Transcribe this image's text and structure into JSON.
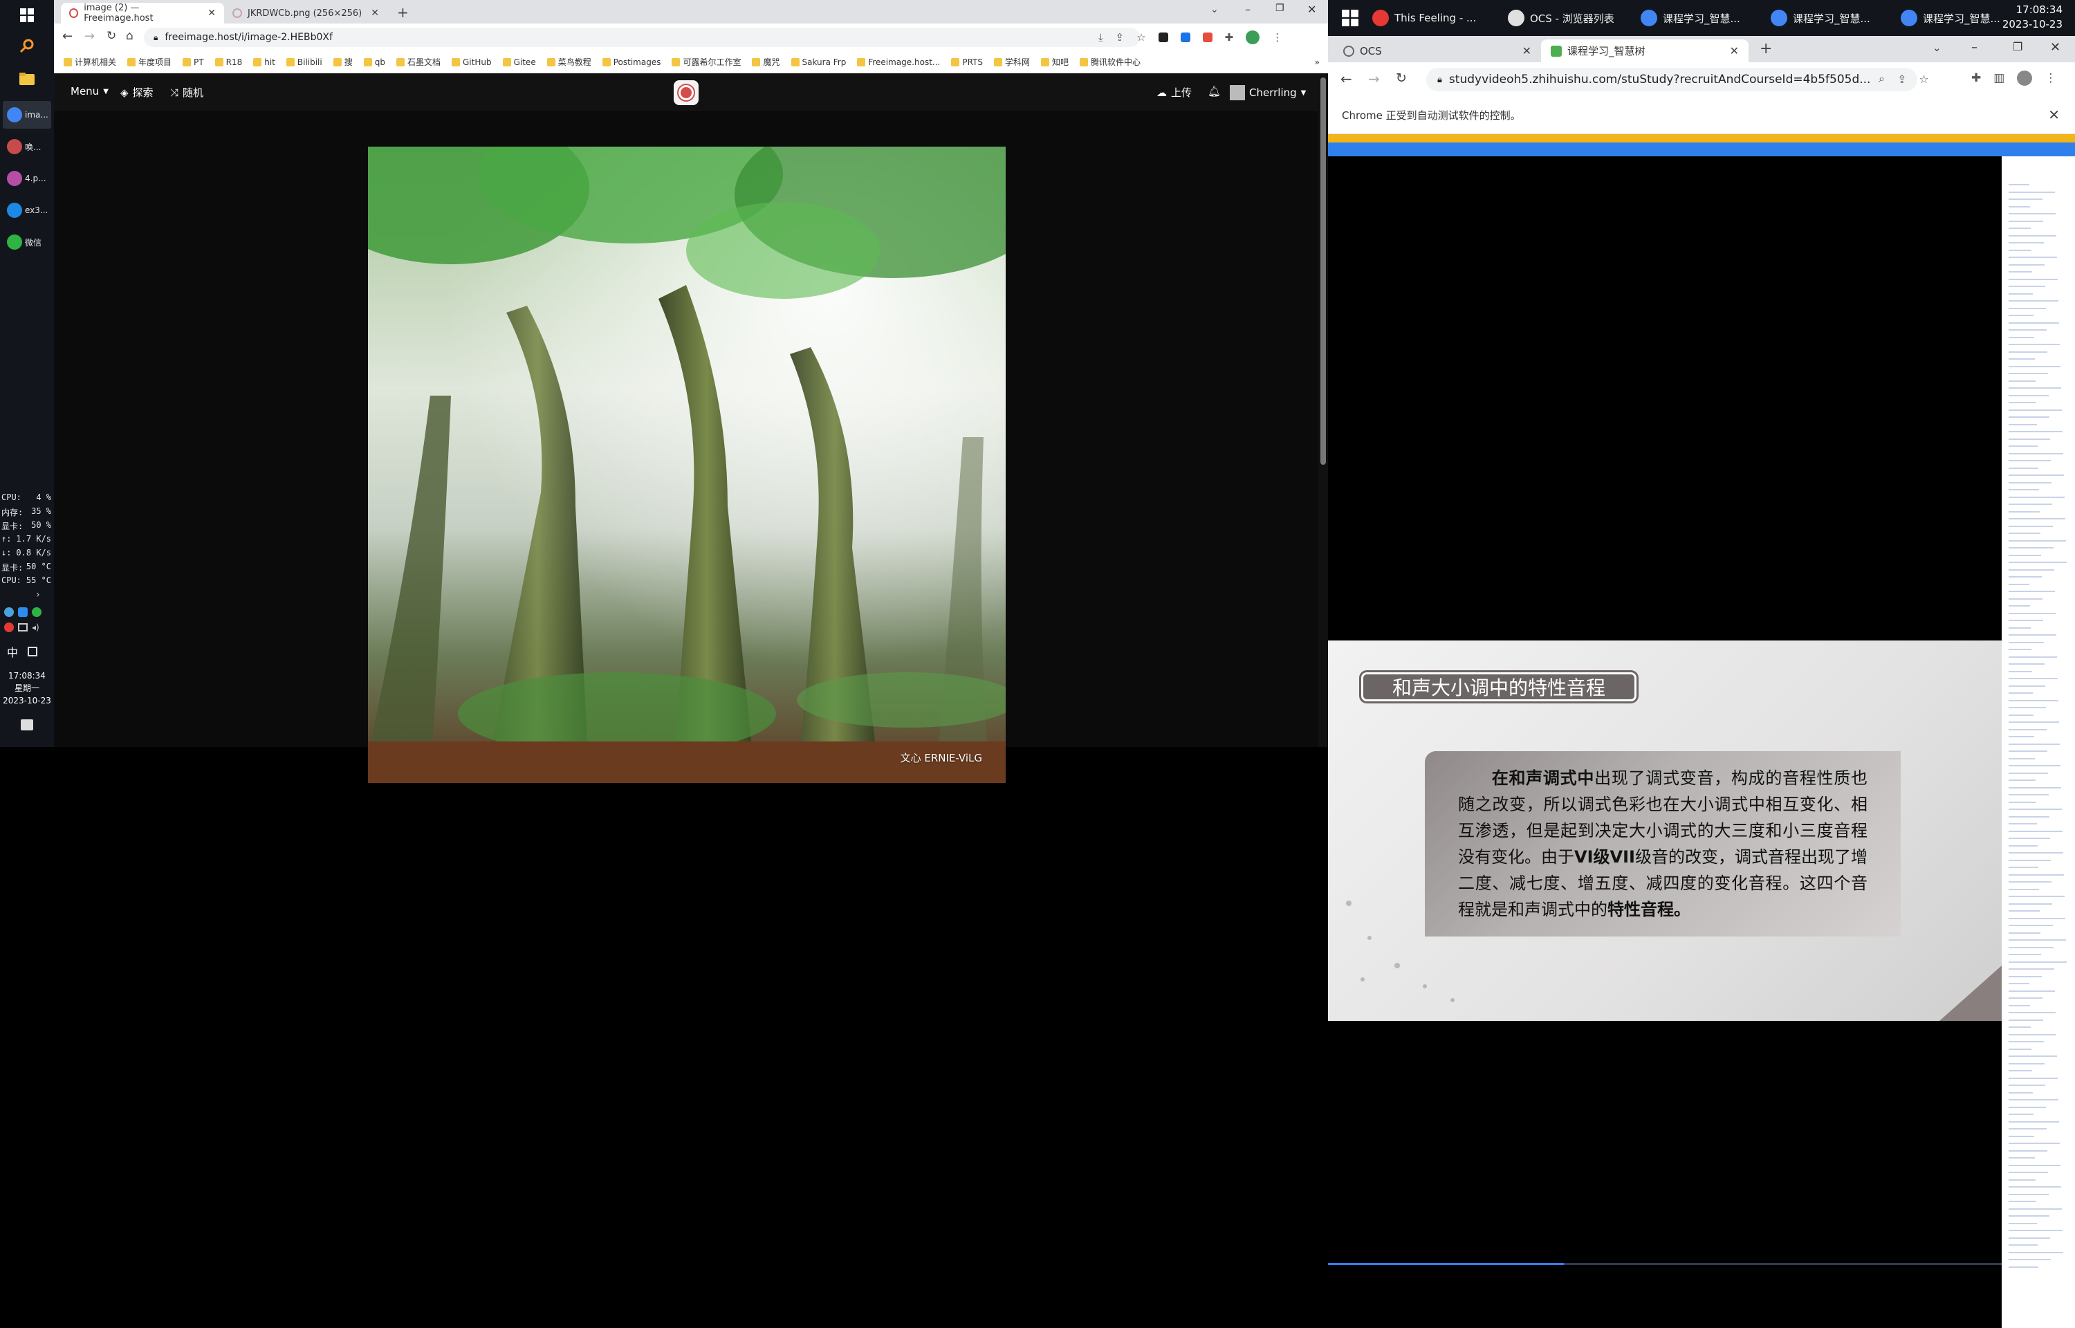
{
  "left": {
    "taskbar": {
      "apps": [
        {
          "label": "ima...",
          "color": "#4285f4",
          "active": true
        },
        {
          "label": "唤...",
          "color": "#c84b4b",
          "active": false
        },
        {
          "label": "4.p...",
          "color": "#b64ea8",
          "active": false
        },
        {
          "label": "ex3...",
          "color": "#1e88e5",
          "active": false
        },
        {
          "label": "微信",
          "color": "#2fb344",
          "active": false
        }
      ],
      "stats": [
        {
          "k": "CPU:",
          "v": "4 %"
        },
        {
          "k": "内存:",
          "v": "35 %"
        },
        {
          "k": "显卡:",
          "v": "50 %"
        },
        {
          "k": "↑:",
          "v": "1.7 K/s"
        },
        {
          "k": "↓:",
          "v": "0.8 K/s"
        },
        {
          "k": "显卡:",
          "v": "50 °C"
        },
        {
          "k": "CPU:",
          "v": "55 °C"
        }
      ],
      "ime": "中",
      "time": "17:08:34",
      "weekday": "星期一",
      "date": "2023-10-23"
    },
    "chrome": {
      "tabs": [
        "image (2) — Freeimage.host",
        "JKRDWCb.png (256×256)"
      ],
      "new_tab": "+",
      "url": "freeimage.host/i/image-2.HEBb0Xf",
      "bookmarks": [
        "计算机相关",
        "年度项目",
        "PT",
        "R18",
        "hit",
        "Bilibili",
        "搜",
        "qb",
        "石墨文档",
        "GitHub",
        "Gitee",
        "菜鸟教程",
        "Postimages",
        "可露希尔工作室",
        "魔咒",
        "Sakura Frp",
        "Freeimage.host...",
        "PRTS",
        "学科网",
        "知吧",
        "腾讯软件中心"
      ],
      "more_bookmarks": "»"
    },
    "site": {
      "menu": "Menu",
      "explore": "探索",
      "random": "随机",
      "upload": "上传",
      "user": "Cherrling",
      "photo_caption": "文心 ERNIE-ViLG"
    }
  },
  "right": {
    "taskbar": {
      "tasks": [
        {
          "label": "This Feeling - ...",
          "color": "#e53935"
        },
        {
          "label": "OCS - 浏览器列表",
          "color": "#e0e0e0"
        },
        {
          "label": "课程学习_智慧...",
          "color": "#4285f4"
        },
        {
          "label": "课程学习_智慧...",
          "color": "#4285f4"
        },
        {
          "label": "课程学习_智慧...",
          "color": "#4285f4"
        }
      ],
      "time": "17:08:34",
      "date": "2023-10-23"
    },
    "chrome": {
      "tabs": [
        "OCS",
        "课程学习_智慧树"
      ],
      "new_tab": "+",
      "url": "studyvideoh5.zhihuishu.com/stuStudy?recruitAndCourseId=4b5f505d...",
      "infobar": "Chrome 正受到自动测试软件的控制。"
    },
    "slide": {
      "title": "和声大小调中的特性音程",
      "bold_lead": "在和声调式中",
      "text_1": "出现了调式变音，构成的音程性质也随之改变，所以调式色彩也在大小调式中相互变化、相互渗透，但是起到决定大小调式的大三度和小三度音程没有变化。由于",
      "bold_mid": "VI级VII",
      "text_2": "级音的改变，调式音程出现了增二度、减七度、增五度、减四度的变化音程。这四个音程就是和声调式中的",
      "bold_end": "特性音程。"
    }
  }
}
